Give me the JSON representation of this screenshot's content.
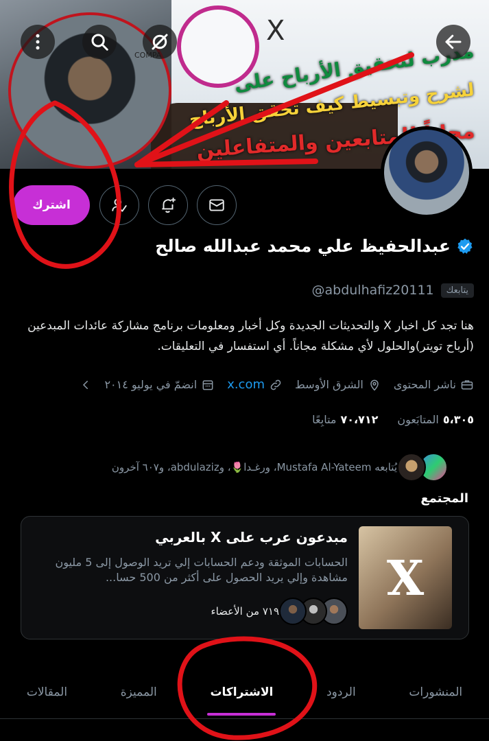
{
  "banner": {
    "line1": "مدرب لتحقيق الأرباح على",
    "line2": "لشرح وتبسيط كيف تحقق الأرباح",
    "line3": "مجاناً للمتابعين والمتفاعلين",
    "x_logo": "X",
    "company_text": "COMPA"
  },
  "overlay": {
    "back": "arrow-left-icon",
    "search": "search-icon",
    "more": "more-vertical-icon"
  },
  "actions": {
    "subscribe_label": "اشترك",
    "colors": {
      "subscribe": "#c72fd6",
      "accent": "#1d9bf0"
    }
  },
  "profile": {
    "name": "عبدالحفيظ علي محمد عبدالله صالح",
    "handle": "@abdulhafiz20111",
    "follows_you": "يتابعك",
    "bio": "هنا تجد كل اخبار X  والتحديثات الجديدة وكل أخبار ومعلومات برنامج مشاركة عائدات المبدعين (أرباح تويتر)والحلول لأي مشكلة مجاناً.  أي استفسار في التعليقات.",
    "meta": {
      "category": "ناشر المحتوى",
      "location": "الشرق الأوسط",
      "link": "x.com",
      "joined": "انضمّ في يوليو ٢٠١٤"
    },
    "stats": {
      "following_count": "٥،٣٠٥",
      "following_label": "المتابَعون",
      "followers_count": "٧٠،٧١٢",
      "followers_label": "متابِعًا"
    },
    "followed_by": "يُتابعه Mustafa Al-Yateem، ورغـدا🌷، وabdulaziz، و٦٠٧ آخرون"
  },
  "community": {
    "heading": "المجتمع",
    "title": "مبدعون عرب على X بالعربي",
    "description": "الحسابات الموثقة ودعم الحسابات إلي تريد الوصول إلى 5 مليون مشاهدة وإلي يريد الحصول على أكثر من 500 حسا...",
    "members": "٧١٩ من الأعضاء"
  },
  "tabs": [
    {
      "label": "المنشورات"
    },
    {
      "label": "الردود"
    },
    {
      "label": "الاشتراكات"
    },
    {
      "label": "المميزة"
    },
    {
      "label": "المقالات"
    }
  ]
}
